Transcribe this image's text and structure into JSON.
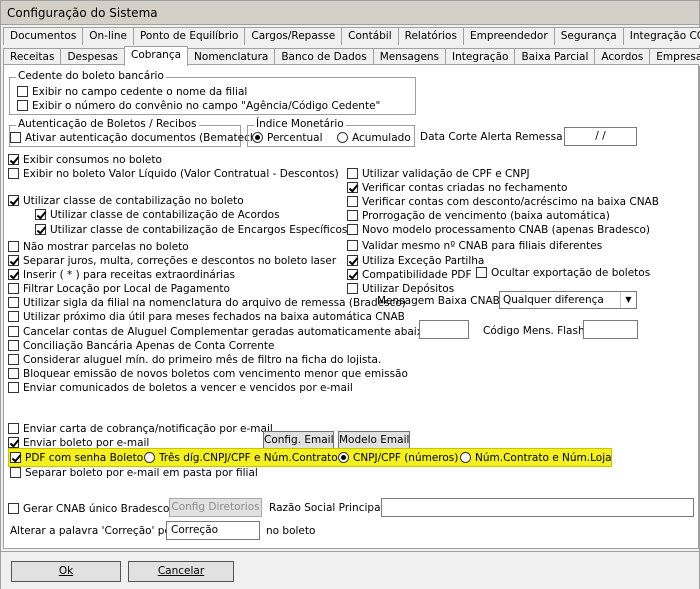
{
  "window": {
    "title": "Configuração do Sistema"
  },
  "tabs_row1": [
    "Documentos",
    "On-line",
    "Ponto de Equilíbrio",
    "Cargos/Repasse",
    "Contábil",
    "Relatórios",
    "Empreendedor",
    "Segurança",
    "Integração COM21"
  ],
  "tabs_row2": [
    "Receitas",
    "Despesas",
    "Cobrança",
    "Nomenclatura",
    "Banco de Dados",
    "Mensagens",
    "Integração",
    "Baixa Parcial",
    "Acordos",
    "Empresa"
  ],
  "active_tab": "Cobrança",
  "cedente": {
    "title": "Cedente do boleto bancário",
    "opt1": "Exibir no campo cedente o nome da filial",
    "opt2": "Exibir o número do convênio no campo \"Agência/Código Cedente\""
  },
  "autent": {
    "title": "Autenticação de Boletos / Recibos",
    "opt": "Ativar autenticação documentos (Bematech)"
  },
  "indice": {
    "title": "Índice Monetário",
    "r1": "Percentual",
    "r2": "Acumulado"
  },
  "data_corte": {
    "label": "Data Corte Alerta Remessa",
    "value": "/ /"
  },
  "left": {
    "c1": "Exibir consumos no boleto",
    "c2": "Exibir no boleto Valor Líquido (Valor Contratual - Descontos)",
    "c3": "Utilizar classe de contabilização no boleto",
    "c3a": "Utilizar classe de contabilização de Acordos",
    "c3b": "Utilizar classe de contabilização de Encargos Específicos",
    "c4": "Não mostrar parcelas no boleto",
    "c5": "Separar juros, multa, correções e descontos no boleto laser",
    "c6": "Inserir ( * ) para receitas extraordinárias",
    "c7": "Filtrar Locação por Local de Pagamento",
    "c8": "Utilizar sigla da filial na nomenclatura do arquivo de remessa (Bradesco)",
    "c9": "Utilizar próximo dia útil para meses fechados na baixa automática CNAB",
    "c10": "Cancelar contas de Aluguel Complementar geradas automaticamente abaixo de R$",
    "c11": "Conciliação Bancária Apenas de Conta Corrente",
    "c12": "Considerar aluguel mín. do primeiro mês de filtro na ficha do lojista.",
    "c13": "Bloquear emissão de novos boletos com vencimento menor que emissão",
    "c14": "Enviar comunicados de boletos a vencer e vencidos por e-mail"
  },
  "right": {
    "r1": "Utilizar validação de CPF e CNPJ",
    "r2": "Verificar contas criadas no fechamento",
    "r3": "Verificar contas com desconto/acréscimo na baixa CNAB",
    "r4": "Prorrogação de vencimento (baixa automática)",
    "r5": "Novo modelo processamento CNAB (apenas Bradesco)",
    "r6": "Validar mesmo nº CNAB para filiais diferentes",
    "r7": "Utiliza Exceção Partilha",
    "r8": "Compatibilidade PDF",
    "r8b": "Ocultar exportação de boletos",
    "r9": "Utilizar Depósitos"
  },
  "mensagem_baixa": {
    "label": "Mensagem Baixa CNAB:",
    "value": "Qualquer diferença"
  },
  "codigo_flash": {
    "label": "Código Mens. Flash:",
    "value": ""
  },
  "cancel_value": "",
  "email": {
    "e1": "Enviar carta de cobrança/notificação por e-mail",
    "e2": "Enviar boleto por e-mail",
    "config_btn": "Config. Email",
    "modelo_btn": "Modelo Email",
    "pdf_senha": "PDF com senha Boleto",
    "opt_a": "Três díg.CNPJ/CPF e Núm.Contrato",
    "opt_b": "CNPJ/CPF (números)",
    "opt_c": "Núm.Contrato e Núm.Loja",
    "separar": "Separar boleto por e-mail em pasta por filial"
  },
  "cnab": {
    "label": "Gerar CNAB único Bradesco",
    "btn": "Config Diretorios",
    "razao_label": "Razão Social Principal",
    "razao_value": ""
  },
  "correcao": {
    "label": "Alterar a palavra 'Correção' por",
    "value": "Correção",
    "suffix": "no boleto"
  },
  "buttons": {
    "ok": "Ok",
    "cancel": "Cancelar"
  }
}
